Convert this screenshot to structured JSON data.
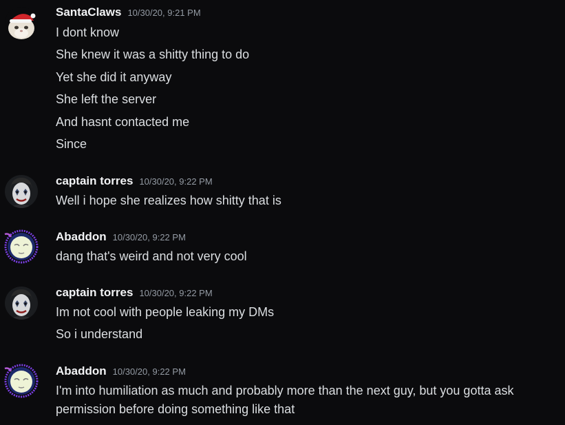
{
  "messages": [
    {
      "username": "SantaClaws",
      "timestamp": "10/30/20, 9:21 PM",
      "avatar": "santa-cat-avatar",
      "lines": [
        "I dont know",
        "She knew it was a shitty thing to do",
        "Yet she did it anyway",
        "She left the server",
        "And hasnt contacted me",
        "Since"
      ]
    },
    {
      "username": "captain torres",
      "timestamp": "10/30/20, 9:22 PM",
      "avatar": "clown-face-avatar",
      "lines": [
        "Well i hope she realizes how shitty that is"
      ]
    },
    {
      "username": "Abaddon",
      "timestamp": "10/30/20, 9:22 PM",
      "avatar": "pale-creature-avatar",
      "lines": [
        "dang that's weird and not very cool"
      ]
    },
    {
      "username": "captain torres",
      "timestamp": "10/30/20, 9:22 PM",
      "avatar": "clown-face-avatar",
      "lines": [
        "Im not cool with people leaking my DMs",
        "So i understand"
      ]
    },
    {
      "username": "Abaddon",
      "timestamp": "10/30/20, 9:22 PM",
      "avatar": "pale-creature-avatar",
      "lines": [
        "I'm into humiliation as much and probably more than the next guy, but you gotta ask permission before doing something like that"
      ]
    }
  ],
  "colors": {
    "background": "#0b0b0d",
    "username": "#f2f3f5",
    "timestamp": "#949ba4",
    "text": "#dbdee1"
  }
}
